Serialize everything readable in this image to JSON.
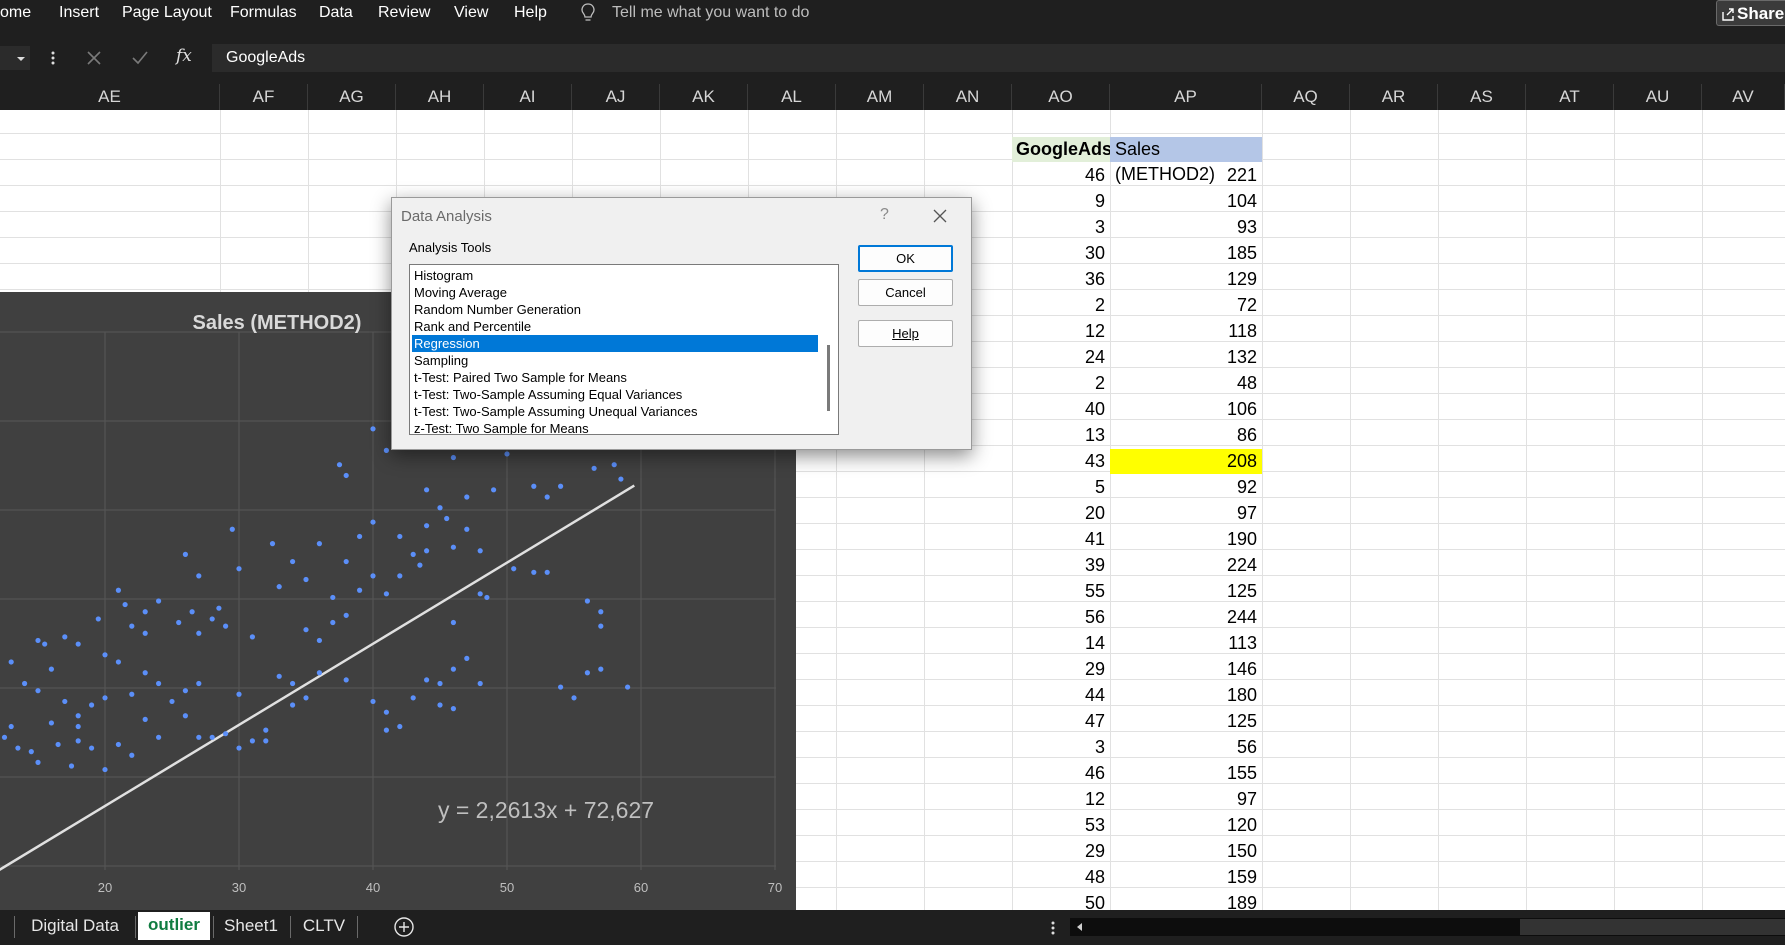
{
  "menu": {
    "items": [
      "ome",
      "Insert",
      "Page Layout",
      "Formulas",
      "Data",
      "Review",
      "View",
      "Help"
    ],
    "tell_me": "Tell me what you want to do",
    "share": "Share"
  },
  "formula_bar": {
    "content": "GoogleAds",
    "fx": "fx"
  },
  "columns": [
    "AE",
    "AF",
    "AG",
    "AH",
    "AI",
    "AJ",
    "AK",
    "AL",
    "AM",
    "AN",
    "AO",
    "AP",
    "AQ",
    "AR",
    "AS",
    "AT",
    "AU",
    "AV"
  ],
  "table": {
    "header_ao": "GoogleAds",
    "header_ap": "Sales (METHOD2)",
    "googleads": [
      46,
      9,
      3,
      30,
      36,
      2,
      12,
      24,
      2,
      40,
      13,
      43,
      5,
      20,
      41,
      39,
      55,
      56,
      14,
      29,
      44,
      47,
      3,
      46,
      12,
      53,
      29,
      48,
      50
    ],
    "sales": [
      221,
      104,
      93,
      185,
      129,
      72,
      118,
      132,
      48,
      106,
      86,
      208,
      92,
      97,
      190,
      224,
      125,
      244,
      113,
      146,
      180,
      125,
      56,
      155,
      97,
      120,
      150,
      159,
      189
    ],
    "highlight_color": "#ffff00"
  },
  "dialog": {
    "title": "Data Analysis",
    "help_glyph": "?",
    "label": "Analysis Tools",
    "tools": [
      "Histogram",
      "Moving Average",
      "Random Number Generation",
      "Rank and Percentile",
      "Regression",
      "Sampling",
      "t-Test: Paired Two Sample for Means",
      "t-Test: Two-Sample Assuming Equal Variances",
      "t-Test: Two-Sample Assuming Unequal Variances",
      "z-Test: Two Sample for Means"
    ],
    "selected": "Regression",
    "ok": "OK",
    "cancel": "Cancel",
    "help": "Help"
  },
  "chart_data": {
    "type": "scatter",
    "title": "Sales (METHOD2)",
    "xlabel": "",
    "ylabel": "",
    "xlim": [
      12,
      71
    ],
    "x_ticks": [
      20,
      30,
      40,
      50,
      60,
      70
    ],
    "trendline_label": "y = 2,2613x + 72,627",
    "trendline": {
      "slope": 2.2613,
      "intercept": 72.627
    },
    "colors": {
      "point": "#5b8ff9",
      "line": "#e0e0e0",
      "background": "#404040"
    },
    "points": [
      [
        40,
        223
      ],
      [
        41,
        217
      ],
      [
        43,
        227
      ],
      [
        45,
        224
      ],
      [
        47,
        219
      ],
      [
        48,
        233
      ],
      [
        46,
        215
      ],
      [
        50,
        216
      ],
      [
        37.5,
        213
      ],
      [
        38,
        210
      ],
      [
        52,
        207
      ],
      [
        54,
        207
      ],
      [
        56.5,
        212
      ],
      [
        58,
        213
      ],
      [
        58.5,
        209
      ],
      [
        53,
        204
      ],
      [
        44,
        206
      ],
      [
        45.5,
        198
      ],
      [
        47,
        204
      ],
      [
        49,
        206
      ],
      [
        45,
        201
      ],
      [
        39,
        193
      ],
      [
        40,
        197
      ],
      [
        42,
        193
      ],
      [
        44,
        196
      ],
      [
        43,
        188
      ],
      [
        47,
        195
      ],
      [
        46,
        190
      ],
      [
        48,
        189
      ],
      [
        50.5,
        184
      ],
      [
        52,
        183
      ],
      [
        53,
        183
      ],
      [
        29.5,
        195
      ],
      [
        32.5,
        191
      ],
      [
        34,
        186
      ],
      [
        36,
        191
      ],
      [
        38,
        186
      ],
      [
        40,
        182
      ],
      [
        42,
        182
      ],
      [
        44,
        189
      ],
      [
        26,
        188
      ],
      [
        27,
        182
      ],
      [
        30,
        184
      ],
      [
        33,
        179
      ],
      [
        35,
        181
      ],
      [
        37,
        176
      ],
      [
        39,
        178
      ],
      [
        41,
        177
      ],
      [
        43.5,
        185
      ],
      [
        21,
        178
      ],
      [
        21.5,
        174
      ],
      [
        23,
        172
      ],
      [
        24,
        175
      ],
      [
        25.5,
        169
      ],
      [
        26.5,
        172
      ],
      [
        28,
        170
      ],
      [
        28.5,
        173
      ],
      [
        19.5,
        170
      ],
      [
        22,
        168
      ],
      [
        23,
        166
      ],
      [
        27,
        166
      ],
      [
        29,
        168
      ],
      [
        31,
        165
      ],
      [
        35,
        167
      ],
      [
        36,
        164
      ],
      [
        37,
        169
      ],
      [
        38,
        171
      ],
      [
        46,
        169
      ],
      [
        48,
        177
      ],
      [
        56,
        175
      ],
      [
        57,
        172
      ],
      [
        57,
        168
      ],
      [
        48.5,
        176
      ],
      [
        15,
        164
      ],
      [
        15.5,
        163
      ],
      [
        17,
        165
      ],
      [
        18,
        163
      ],
      [
        20,
        160
      ],
      [
        21,
        158
      ],
      [
        23,
        155
      ],
      [
        24,
        152
      ],
      [
        26,
        150
      ],
      [
        27,
        152
      ],
      [
        30,
        149
      ],
      [
        33,
        154
      ],
      [
        34,
        152
      ],
      [
        36,
        155
      ],
      [
        38,
        153
      ],
      [
        44,
        153
      ],
      [
        45,
        152
      ],
      [
        46,
        156
      ],
      [
        47,
        159
      ],
      [
        48,
        152
      ],
      [
        54,
        151
      ],
      [
        55,
        148
      ],
      [
        56,
        155
      ],
      [
        57,
        156
      ],
      [
        59,
        151
      ],
      [
        13,
        158
      ],
      [
        14,
        152
      ],
      [
        15,
        150
      ],
      [
        16,
        156
      ],
      [
        17,
        147
      ],
      [
        18,
        143
      ],
      [
        19,
        146
      ],
      [
        20,
        148
      ],
      [
        22,
        149
      ],
      [
        23,
        142
      ],
      [
        25,
        147
      ],
      [
        26,
        143
      ],
      [
        28,
        137
      ],
      [
        29,
        138
      ],
      [
        31,
        136
      ],
      [
        32,
        139
      ],
      [
        34,
        146
      ],
      [
        35,
        148
      ],
      [
        40,
        147
      ],
      [
        41,
        144
      ],
      [
        42,
        140
      ],
      [
        43,
        148
      ],
      [
        45,
        146
      ],
      [
        46,
        145
      ],
      [
        12.5,
        137
      ],
      [
        13.5,
        134
      ],
      [
        14.5,
        133
      ],
      [
        15,
        130
      ],
      [
        16.5,
        135
      ],
      [
        17.5,
        129
      ],
      [
        18,
        136
      ],
      [
        19,
        134
      ],
      [
        20,
        128
      ],
      [
        21,
        135
      ],
      [
        22,
        132
      ],
      [
        24,
        137
      ],
      [
        27,
        137
      ],
      [
        30,
        134
      ],
      [
        32,
        136
      ],
      [
        13,
        140
      ],
      [
        16,
        141
      ],
      [
        18,
        140
      ],
      [
        41,
        139
      ]
    ]
  },
  "sheets": {
    "tabs": [
      "Digital Data",
      "outlier",
      "Sheet1",
      "CLTV"
    ],
    "active": "outlier"
  }
}
